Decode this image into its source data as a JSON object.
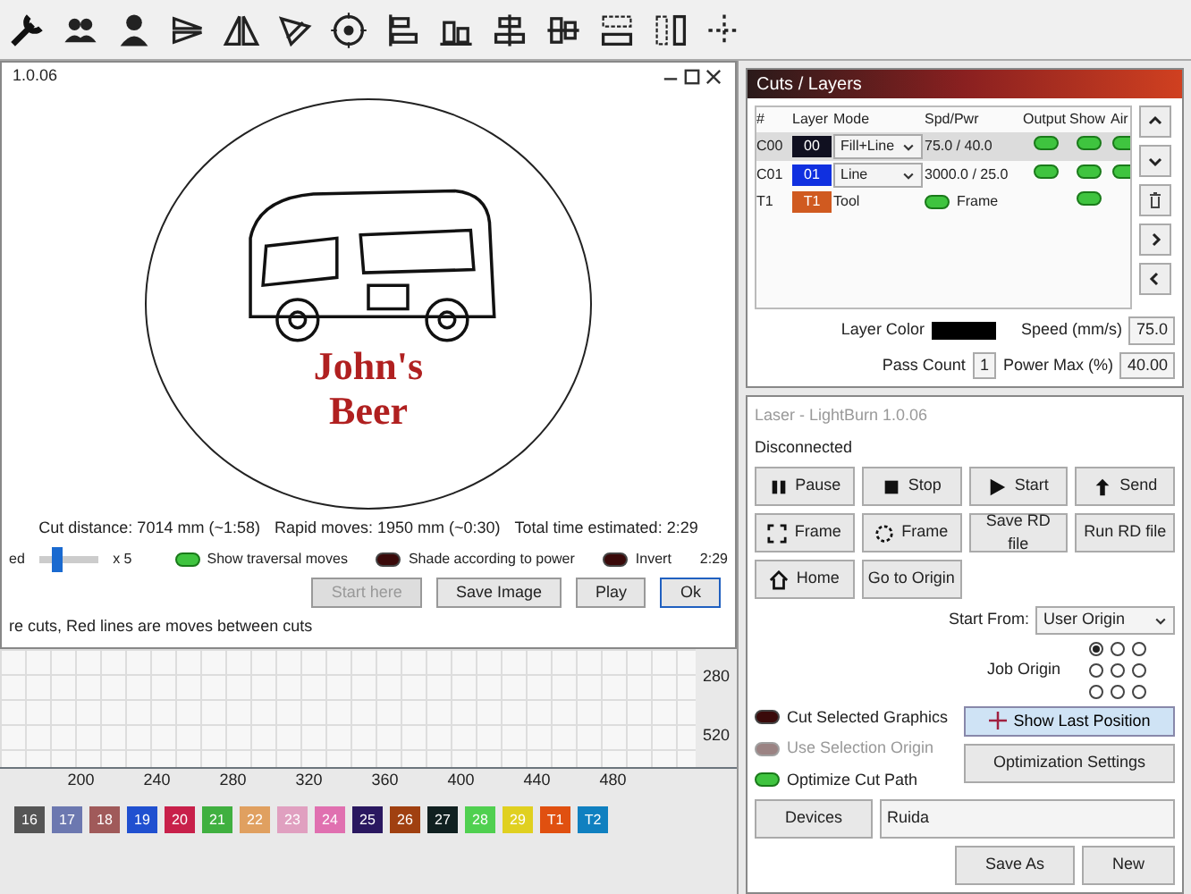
{
  "preview": {
    "title": "1.0.06",
    "artwork_text": [
      "John's",
      "Beer"
    ],
    "stats": [
      "Cut distance: 7014 mm (~1:58)",
      "Rapid moves: 1950 mm (~0:30)",
      "Total time estimated: 2:29"
    ],
    "time": "2:29",
    "speed": {
      "label": "ed",
      "level": 0.3,
      "multiplier": "x 5"
    },
    "toggles": [
      {
        "label": "Show traversal moves",
        "on": true
      },
      {
        "label": "Shade according to power",
        "on": false
      },
      {
        "label": "Invert",
        "on": false
      }
    ],
    "buttons": [
      {
        "label": "Start here",
        "disabled": true
      },
      {
        "label": "Save Image",
        "disabled": false
      },
      {
        "label": "Play",
        "disabled": false
      },
      {
        "label": "Ok",
        "disabled": false
      }
    ],
    "legend": "re cuts, Red lines are moves between cuts"
  },
  "ruler": {
    "x_ticks": [
      "200",
      "240",
      "280",
      "320",
      "360",
      "400",
      "440",
      "480"
    ],
    "y_ticks": [
      "280",
      "520"
    ]
  },
  "palette": [
    {
      "label": "16",
      "color": "#555555"
    },
    {
      "label": "17",
      "color": "#6c78b0"
    },
    {
      "label": "18",
      "color": "#a05a5a"
    },
    {
      "label": "19",
      "color": "#2050d0"
    },
    {
      "label": "20",
      "color": "#c8204a"
    },
    {
      "label": "21",
      "color": "#40b040"
    },
    {
      "label": "22",
      "color": "#e0a060"
    },
    {
      "label": "23",
      "color": "#e0a0c0"
    },
    {
      "label": "24",
      "color": "#e070b0"
    },
    {
      "label": "25",
      "color": "#2a1860"
    },
    {
      "label": "26",
      "color": "#a04010"
    },
    {
      "label": "27",
      "color": "#102020"
    },
    {
      "label": "28",
      "color": "#50d050"
    },
    {
      "label": "29",
      "color": "#e0d020"
    },
    {
      "label": "T1",
      "color": "#e05010"
    },
    {
      "label": "T2",
      "color": "#1080c0"
    }
  ],
  "layers": {
    "title": "Cuts / Layers",
    "columns": [
      "#",
      "Layer",
      "Mode",
      "Spd/Pwr",
      "Output",
      "Show",
      "Air"
    ],
    "rows": [
      {
        "num": "C00",
        "layer": "00",
        "color": "#101020",
        "kind": "cut",
        "mode": "Fill+Line",
        "spd_pwr": "75.0 / 40.0",
        "output": true,
        "show": true,
        "air": true,
        "selected": true
      },
      {
        "num": "C01",
        "layer": "01",
        "color": "#1030e0",
        "kind": "cut",
        "mode": "Line",
        "spd_pwr": "3000.0 / 25.0",
        "output": true,
        "show": true,
        "air": true,
        "selected": false
      },
      {
        "num": "T1",
        "layer": "T1",
        "color": "#d05a20",
        "kind": "tool",
        "mode": "Tool",
        "frame_label": "Frame",
        "frame": true,
        "show": true,
        "selected": false
      }
    ],
    "settings": [
      {
        "label": "Layer Color",
        "kind": "color",
        "color": "#000000"
      },
      {
        "label": "Speed (mm/s)",
        "kind": "number",
        "value": "75.0"
      },
      {
        "label": "Pass Count",
        "kind": "number",
        "value": "1"
      },
      {
        "label": "Power Max (%)",
        "kind": "number",
        "value": "40.00"
      }
    ]
  },
  "laser": {
    "title": "Laser - LightBurn 1.0.06",
    "status": "Disconnected",
    "buttons": [
      {
        "label": "Pause",
        "kind": "pause"
      },
      {
        "label": "Stop",
        "kind": "stop"
      },
      {
        "label": "Start",
        "kind": "start"
      },
      {
        "label": "Send",
        "kind": "send"
      },
      {
        "label": "Frame",
        "kind": "frame-rect"
      },
      {
        "label": "Frame",
        "kind": "frame-circle"
      },
      {
        "label": "Save RD file",
        "kind": "plain"
      },
      {
        "label": "Run RD file",
        "kind": "plain"
      },
      {
        "label": "Home",
        "kind": "home"
      },
      {
        "label": "Go to Origin",
        "kind": "plain"
      }
    ],
    "start_from": {
      "label": "Start From:",
      "value": "User Origin"
    },
    "job_origin": {
      "label": "Job Origin",
      "points": [
        {
          "selected": true
        },
        {
          "selected": false
        },
        {
          "selected": false
        },
        {
          "selected": false
        },
        {
          "selected": false
        },
        {
          "selected": false
        },
        {
          "selected": false
        },
        {
          "selected": false
        },
        {
          "selected": false
        }
      ]
    },
    "toggles": [
      {
        "label": "Cut Selected Graphics",
        "on": false,
        "disabled": false
      },
      {
        "label": "Use Selection Origin",
        "on": false,
        "disabled": true
      },
      {
        "label": "Optimize Cut Path",
        "on": true,
        "disabled": false
      }
    ],
    "show_last_position": "Show Last Position",
    "optimization_settings": "Optimization Settings",
    "devices": "Devices",
    "device": "Ruida",
    "save_as": "Save As",
    "new": "New"
  }
}
